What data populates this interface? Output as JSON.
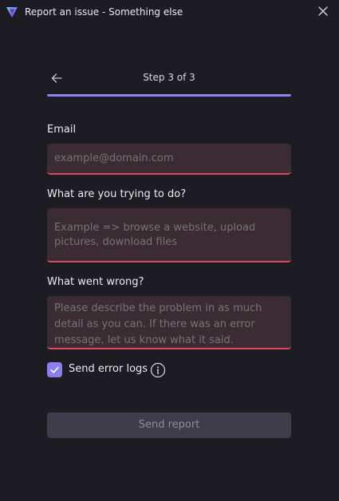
{
  "window": {
    "title": "Report an issue - Something else",
    "accent_color": "#8d85f0"
  },
  "icons": {
    "app": "app-logo-icon",
    "close": "close-icon",
    "back": "arrow-left-icon",
    "check": "check-icon",
    "info": "info-icon"
  },
  "step": {
    "label": "Step 3 of 3",
    "progress": 1.0
  },
  "form": {
    "email": {
      "label": "Email",
      "placeholder": "example@domain.com",
      "value": ""
    },
    "trying": {
      "label": "What are you trying to do?",
      "placeholder": "Example => browse a website, upload pictures, download files",
      "value": ""
    },
    "wrong": {
      "label": "What went wrong?",
      "placeholder": "Please describe the problem in as much detail as you can. If there was an error message, let us know what it said.",
      "value": ""
    },
    "send_logs": {
      "label": "Send error logs",
      "checked": true
    },
    "submit_label": "Send report"
  },
  "colors": {
    "background": "#1d1c22",
    "field_background": "#3b2b33",
    "field_error_border": "#d9495d",
    "checkbox": "#8a7ff0",
    "button_disabled": "#3f3d49"
  }
}
